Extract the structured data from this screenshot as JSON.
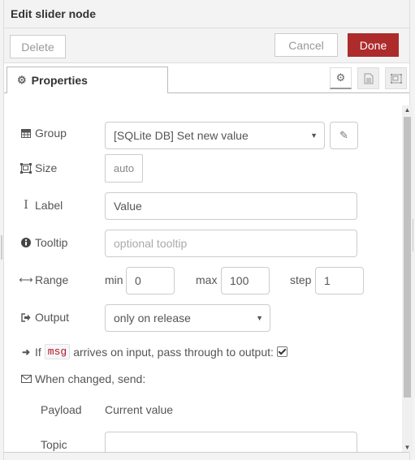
{
  "dialog": {
    "title": "Edit slider node"
  },
  "toolbar": {
    "delete_label": "Delete",
    "cancel_label": "Cancel",
    "done_label": "Done",
    "done_color": "#ad2b2b"
  },
  "tabs": {
    "properties_label": "Properties",
    "icons": [
      "gear-icon",
      "description-icon",
      "appearance-icon"
    ]
  },
  "form": {
    "group": {
      "label": "Group",
      "icon": "table-icon",
      "value": "[SQLite DB] Set new value"
    },
    "size": {
      "label": "Size",
      "icon": "resize-icon",
      "value": "auto"
    },
    "label": {
      "label": "Label",
      "icon": "text-cursor-icon",
      "value": "Value"
    },
    "tooltip": {
      "label": "Tooltip",
      "icon": "info-circle-icon",
      "value": "",
      "placeholder": "optional tooltip"
    },
    "range": {
      "label": "Range",
      "icon": "arrows-h-icon",
      "min_label": "min",
      "min": "0",
      "max_label": "max",
      "max": "100",
      "step_label": "step",
      "step": "1"
    },
    "output": {
      "label": "Output",
      "icon": "sign-out-icon",
      "value": "only on release"
    },
    "passthrough": {
      "prefix": "If",
      "code": "msg",
      "suffix": "arrives on input, pass through to output:",
      "checked": true
    },
    "when_changed": {
      "label": "When changed, send:",
      "icon": "envelope-icon"
    },
    "payload": {
      "label": "Payload",
      "value": "Current value"
    },
    "topic": {
      "label": "Topic",
      "value": ""
    }
  }
}
